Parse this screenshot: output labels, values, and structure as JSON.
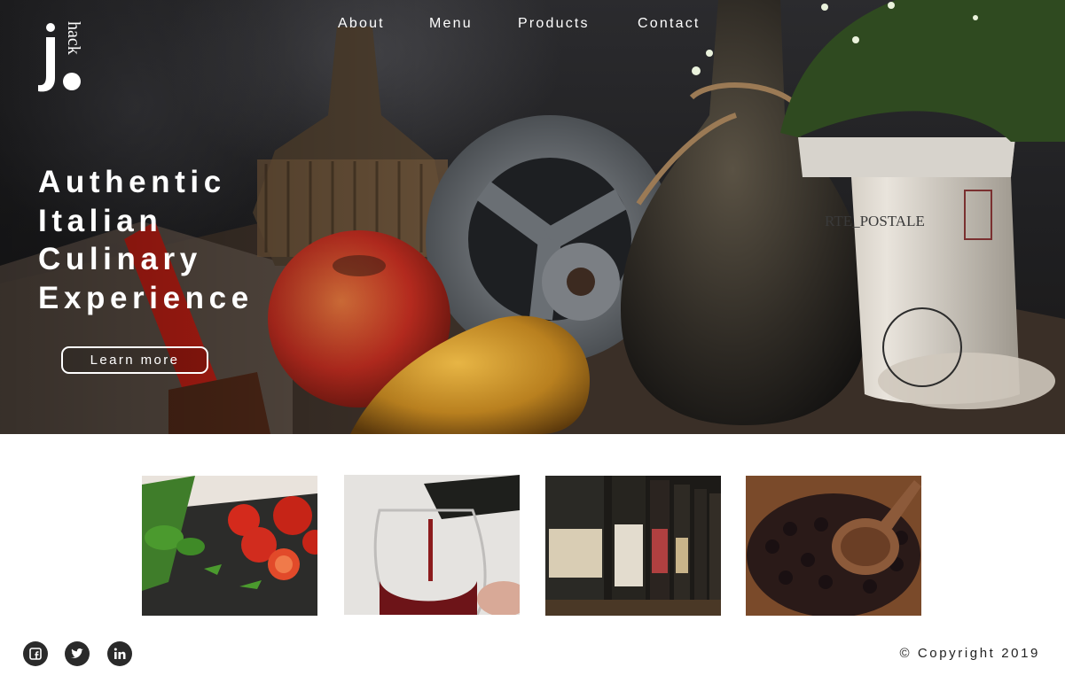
{
  "brand": {
    "logo_letter": "j",
    "logo_word": "hack"
  },
  "nav": {
    "items": [
      {
        "label": "About"
      },
      {
        "label": "Menu"
      },
      {
        "label": "Products"
      },
      {
        "label": "Contact"
      }
    ]
  },
  "hero": {
    "headline_lines": [
      "Authentic",
      "Italian",
      "Culinary",
      "Experience"
    ],
    "cta_label": "Learn more"
  },
  "gallery": {
    "items": [
      {
        "subject": "tomatoes-and-basil"
      },
      {
        "subject": "red-wine-pour"
      },
      {
        "subject": "wine-bottles-shelf"
      },
      {
        "subject": "olives-in-wooden-bowl"
      }
    ]
  },
  "footer": {
    "social": [
      {
        "icon": "facebook-icon"
      },
      {
        "icon": "twitter-icon"
      },
      {
        "icon": "linkedin-icon"
      }
    ],
    "copyright": "© Copyright 2019"
  },
  "colors": {
    "text_light": "#ffffff",
    "text_dark": "#222222",
    "icon_bg": "#2a2a2a",
    "page_bg": "#ffffff"
  }
}
